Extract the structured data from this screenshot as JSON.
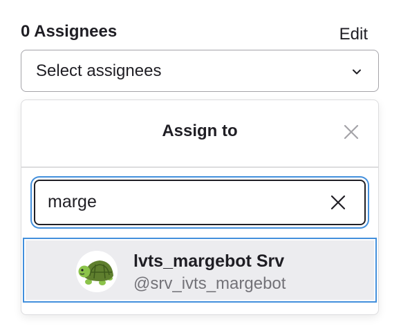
{
  "header": {
    "title": "0 Assignees",
    "edit_label": "Edit"
  },
  "select": {
    "value": "Select assignees",
    "icon": "chevron-down-icon"
  },
  "dropdown": {
    "title": "Assign to",
    "close_icon": "close-icon",
    "search": {
      "value": "marge",
      "clear_icon": "clear-icon"
    },
    "results": [
      {
        "name": "lvts_margebot Srv",
        "username": "@srv_ivts_margebot",
        "avatar_icon": "turtle-avatar-icon"
      }
    ]
  },
  "colors": {
    "focus": "#428fdc",
    "selected_bg": "#ececef",
    "text": "#1f1e24",
    "muted": "#737278"
  }
}
